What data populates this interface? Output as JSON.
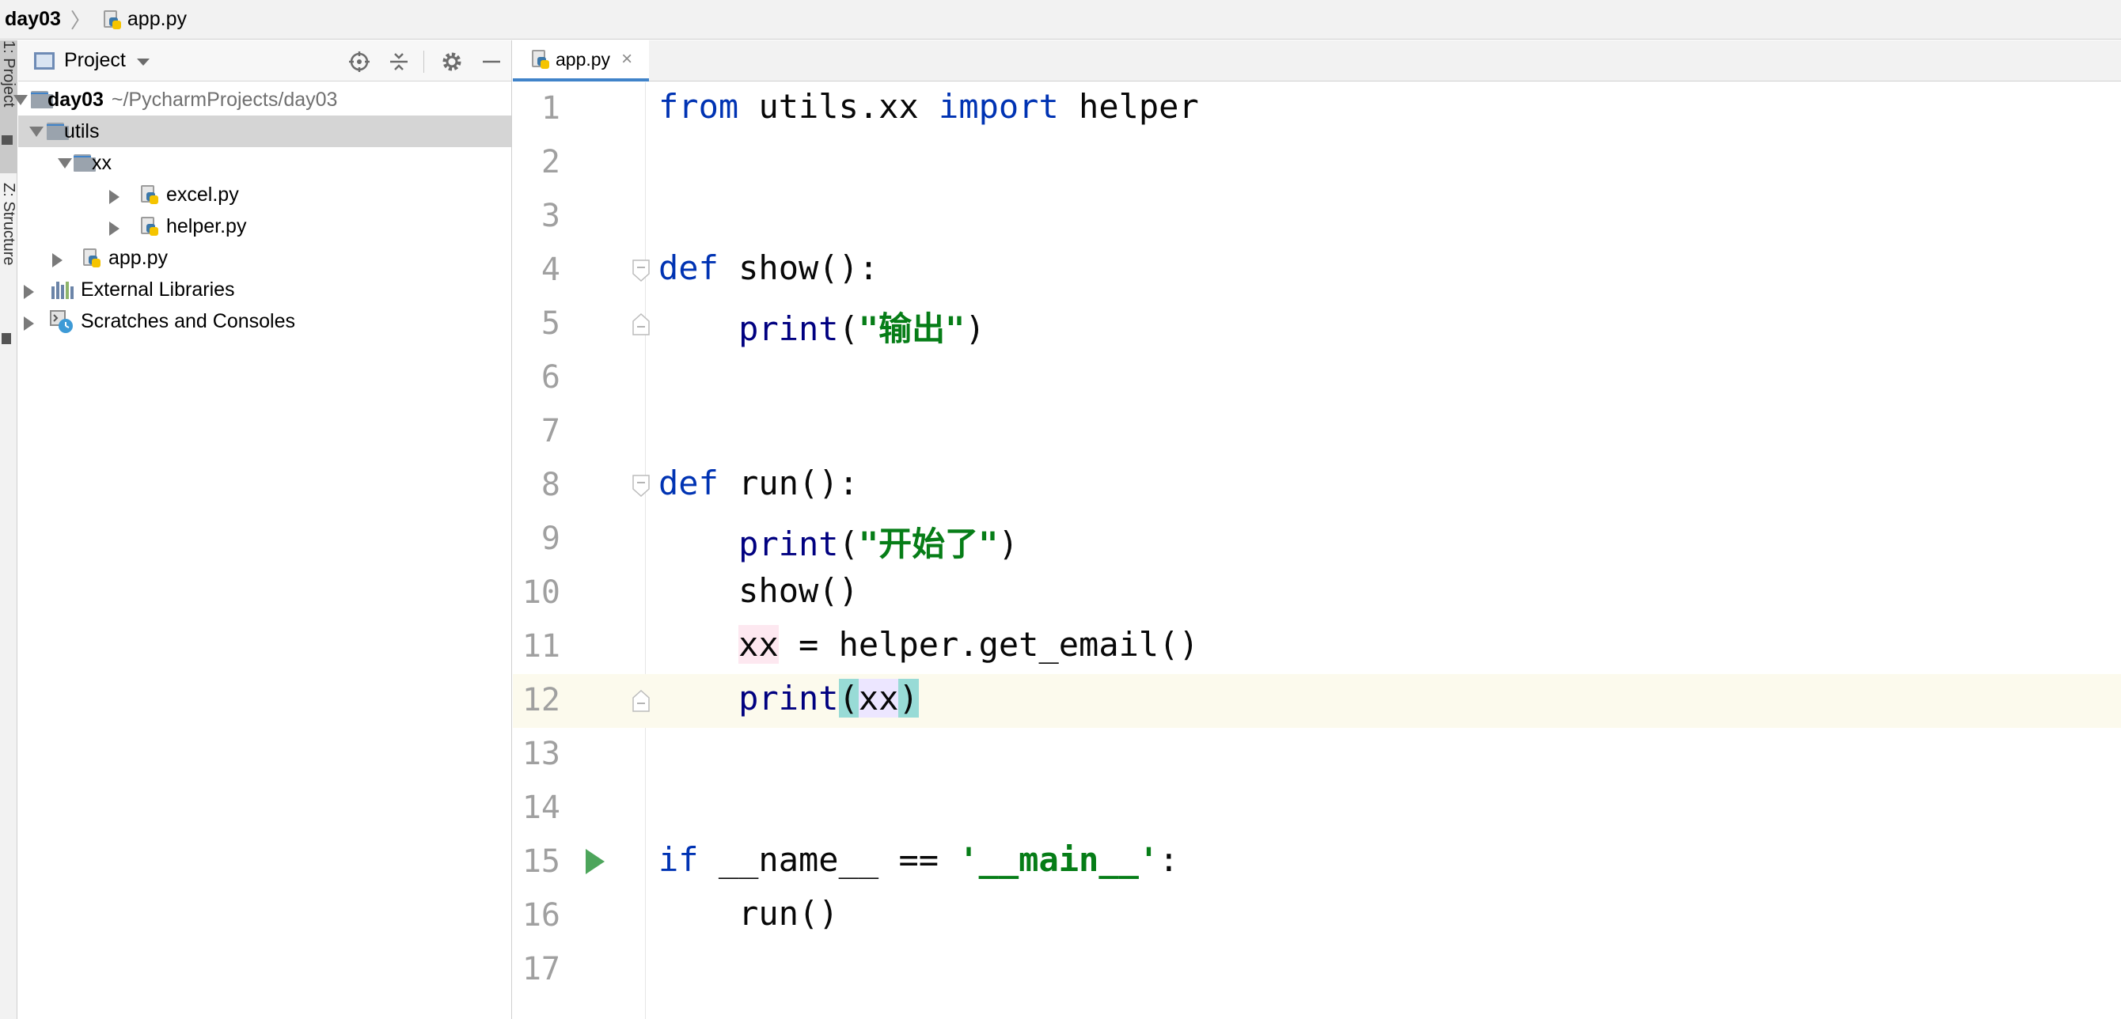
{
  "breadcrumb": {
    "project": "day03",
    "file": "app.py"
  },
  "tool_windows": {
    "project": "1: Project",
    "structure": "Z: Structure"
  },
  "project_panel": {
    "title": "Project",
    "tree": {
      "root": {
        "name": "day03",
        "path": "~/PycharmProjects/day03"
      },
      "utils": "utils",
      "xx": "xx",
      "excel": "excel.py",
      "helper": "helper.py",
      "app": "app.py",
      "external_libraries": "External Libraries",
      "scratches": "Scratches and Consoles"
    }
  },
  "editor": {
    "tab_label": "app.py",
    "current_line": 12,
    "line_numbers": [
      "1",
      "2",
      "3",
      "4",
      "5",
      "6",
      "7",
      "8",
      "9",
      "10",
      "11",
      "12",
      "13",
      "14",
      "15",
      "16",
      "17"
    ],
    "code": {
      "l1": {
        "kw1": "from",
        "mod": " utils.xx ",
        "kw2": "import",
        "name": " helper"
      },
      "l4": {
        "kw": "def",
        "rest": " show():"
      },
      "l5": {
        "indent": "    ",
        "fn": "print",
        "open": "(",
        "str": "\"输出\"",
        "close": ")"
      },
      "l8": {
        "kw": "def",
        "rest": " run():"
      },
      "l9": {
        "indent": "    ",
        "fn": "print",
        "open": "(",
        "str": "\"开始了\"",
        "close": ")"
      },
      "l10": {
        "text": "    show()"
      },
      "l11": {
        "indent": "    ",
        "var": "xx",
        "rest": " = helper.get_email()"
      },
      "l12": {
        "indent": "    ",
        "fn": "print",
        "open": "(",
        "arg": "xx",
        "close": ")"
      },
      "l15": {
        "kw": "if",
        "mid": " __name__ == ",
        "str": "'__main__'",
        "end": ":"
      },
      "l16": {
        "text": "    run()"
      }
    }
  }
}
